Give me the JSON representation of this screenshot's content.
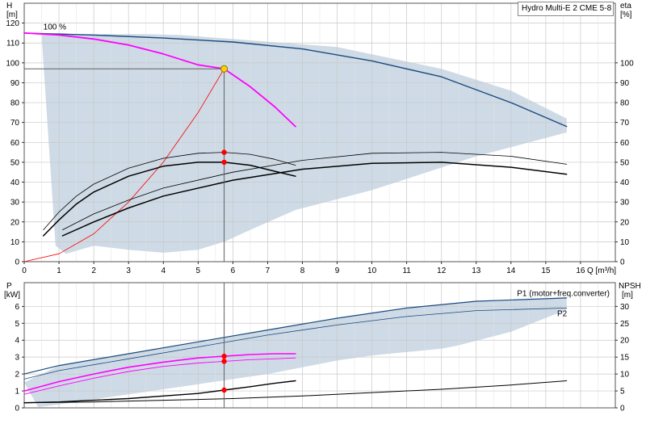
{
  "chart_data": [
    {
      "type": "line",
      "title": "Hydro Multi-E 2 CME 5-8",
      "xlabel": "Q [m³/h]",
      "ylabel_left": "H",
      "ylabel_left_unit": "[m]",
      "ylabel_right": "eta",
      "ylabel_right_unit": "[%]",
      "xlim": [
        0,
        17
      ],
      "ylim_left": [
        0,
        130
      ],
      "ylim_right": [
        0,
        130
      ],
      "x_ticks": [
        0,
        1,
        2,
        3,
        4,
        5,
        6,
        7,
        8,
        9,
        10,
        11,
        12,
        13,
        14,
        15,
        16
      ],
      "x_tick_labels": [
        "0",
        "1",
        "2",
        "3",
        "4",
        "5",
        "6",
        "7",
        "8",
        "9",
        "10",
        "11",
        "12",
        "13",
        "14",
        "15",
        "16"
      ],
      "y_left_ticks": [
        0,
        10,
        20,
        30,
        40,
        50,
        60,
        70,
        80,
        90,
        100,
        110,
        120
      ],
      "y_right_ticks": [
        0,
        10,
        20,
        30,
        40,
        50,
        60,
        70,
        80,
        90,
        100
      ],
      "grid": true,
      "speed_label": "100 %",
      "region_color": "#c9d6e2",
      "series": [
        {
          "color": "#1a4a80",
          "width": 1.4,
          "x": [
            0,
            2,
            4,
            6,
            8,
            10,
            12,
            14,
            15.6
          ],
          "y": [
            115,
            114,
            112.5,
            110.5,
            107,
            101,
            93,
            80,
            68
          ]
        },
        {
          "color": "#ff00ff",
          "width": 1.8,
          "x": [
            0,
            1,
            2,
            3,
            4,
            5,
            5.75,
            6.5,
            7.2,
            7.8
          ],
          "y": [
            115,
            114,
            112,
            109,
            104.5,
            99,
            97,
            88,
            78,
            68
          ]
        },
        {
          "color": "#ff0000",
          "width": 0.8,
          "x": [
            0,
            1,
            2,
            3,
            4,
            5,
            5.75
          ],
          "y": [
            0,
            4,
            14,
            30,
            50,
            75,
            97
          ]
        },
        {
          "color": "#000000",
          "width": 1.5,
          "x": [
            0.55,
            1,
            1.5,
            2,
            3,
            4,
            5,
            5.75,
            6.5,
            7.2,
            7.8
          ],
          "y": [
            13,
            21,
            29,
            35,
            43,
            48,
            50,
            50,
            48.5,
            45.5,
            43
          ]
        },
        {
          "color": "#000000",
          "width": 0.8,
          "x": [
            0.55,
            1,
            1.5,
            2,
            3,
            4,
            5,
            5.75,
            6.5,
            7.2,
            7.8
          ],
          "y": [
            16,
            25,
            33,
            39,
            47,
            52,
            54.5,
            55,
            54,
            51.5,
            48.5
          ]
        },
        {
          "color": "#000000",
          "width": 1.5,
          "x": [
            1.1,
            2,
            3,
            4,
            6,
            8,
            10,
            12,
            14,
            15.6
          ],
          "y": [
            13,
            20,
            27,
            33,
            41,
            46.5,
            49.5,
            50,
            47.5,
            44
          ]
        },
        {
          "color": "#000000",
          "width": 0.8,
          "x": [
            1.1,
            2,
            3,
            4,
            6,
            8,
            10,
            12,
            14,
            15.6
          ],
          "y": [
            16,
            24,
            31,
            37,
            45,
            51,
            54.5,
            55,
            53,
            49
          ]
        }
      ],
      "region": {
        "x": [
          0.5,
          1,
          1.5,
          2.5,
          3.5,
          4.5,
          6,
          9,
          12,
          14,
          15.6,
          15.6,
          13,
          10,
          7.8,
          6.5,
          5.75,
          5,
          4,
          3,
          2,
          1.2,
          0.9,
          0.5
        ],
        "y": [
          114,
          115,
          114.5,
          114.5,
          114.5,
          114,
          112,
          108,
          97,
          86,
          72,
          65,
          53,
          36,
          26,
          16,
          10,
          6,
          4.5,
          6,
          8,
          4,
          8,
          114
        ]
      },
      "duty_point": {
        "x": 5.75,
        "y": 97
      },
      "markers": [
        {
          "x": 5.75,
          "y": 55
        },
        {
          "x": 5.75,
          "y": 50
        }
      ]
    },
    {
      "type": "line",
      "xlim": [
        0,
        17
      ],
      "ylabel_left": "P",
      "ylabel_left_unit": "[kW]",
      "ylabel_right": "NPSH",
      "ylabel_right_unit": "[m]",
      "ylim_left": [
        0,
        7.4
      ],
      "ylim_right": [
        0,
        37
      ],
      "y_left_ticks": [
        0,
        1,
        2,
        3,
        4,
        5,
        6
      ],
      "y_right_ticks": [
        0,
        5,
        10,
        15,
        20,
        25,
        30
      ],
      "grid": true,
      "annotations": [
        {
          "text": "P1 (motor+freq.converter)",
          "color": "#1a4a80"
        },
        {
          "text": "P2",
          "color": "#1a4a80"
        }
      ],
      "region": {
        "x": [
          0,
          1,
          3,
          5,
          7,
          9,
          11,
          13,
          15.6,
          15.6,
          14,
          12.5,
          12,
          11,
          10,
          9,
          8,
          7,
          6,
          5,
          4,
          3,
          2,
          1,
          0.4,
          0
        ],
        "y": [
          1.5,
          2.5,
          3.2,
          3.9,
          4.6,
          5.3,
          5.9,
          6.3,
          6.5,
          5.8,
          4.5,
          3.7,
          3.5,
          3.3,
          3.1,
          2.8,
          2.4,
          2,
          1.7,
          1.4,
          1.1,
          0.8,
          0.5,
          0.2,
          0.05,
          1.5
        ]
      },
      "series": [
        {
          "color": "#1a4a80",
          "width": 1.2,
          "x": [
            0,
            1,
            3,
            5,
            7,
            9,
            11,
            13,
            15.6
          ],
          "y": [
            2,
            2.5,
            3.2,
            3.9,
            4.6,
            5.3,
            5.9,
            6.3,
            6.5
          ]
        },
        {
          "color": "#1a4a80",
          "width": 0.8,
          "x": [
            0,
            1,
            3,
            5,
            7,
            9,
            11,
            13,
            15.6
          ],
          "y": [
            1.7,
            2.2,
            2.9,
            3.6,
            4.3,
            4.9,
            5.4,
            5.75,
            5.9
          ]
        },
        {
          "color": "#ff00ff",
          "width": 1.6,
          "x": [
            0,
            1,
            2,
            3,
            4,
            5,
            5.75,
            6.5,
            7.2,
            7.8
          ],
          "y": [
            1,
            1.55,
            2,
            2.4,
            2.7,
            2.95,
            3.05,
            3.15,
            3.2,
            3.2
          ]
        },
        {
          "color": "#ff00ff",
          "width": 0.9,
          "x": [
            0,
            1,
            2,
            3,
            4,
            5,
            5.75,
            6.5,
            7.2,
            7.8
          ],
          "y": [
            0.8,
            1.3,
            1.75,
            2.15,
            2.45,
            2.65,
            2.75,
            2.85,
            2.9,
            2.95
          ]
        },
        {
          "color": "#000000",
          "width": 1.4,
          "x": [
            0,
            1,
            2,
            3,
            4,
            5,
            5.75,
            6.5,
            7.2,
            7.8
          ],
          "y": [
            0.3,
            0.35,
            0.45,
            0.55,
            0.7,
            0.85,
            1.05,
            1.25,
            1.45,
            1.6
          ]
        },
        {
          "color": "#000000",
          "width": 1,
          "x": [
            0,
            2,
            4,
            6,
            8,
            10,
            12,
            14,
            15.6
          ],
          "y": [
            0.3,
            0.35,
            0.45,
            0.55,
            0.7,
            0.9,
            1.1,
            1.35,
            1.6
          ]
        }
      ],
      "markers": [
        {
          "x": 5.75,
          "y": 3.05
        },
        {
          "x": 5.75,
          "y": 2.75
        },
        {
          "x": 5.75,
          "y": 1.05
        }
      ]
    }
  ]
}
